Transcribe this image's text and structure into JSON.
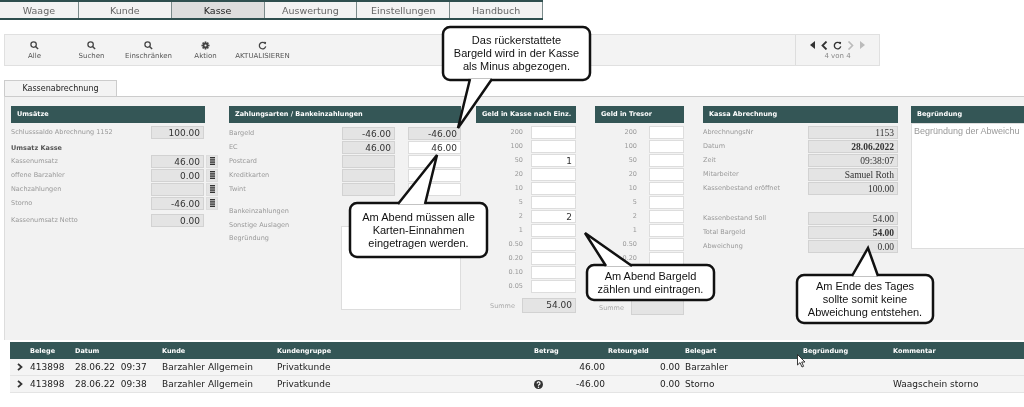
{
  "main_tabs": [
    {
      "label": "Waage",
      "selected": false
    },
    {
      "label": "Kunde",
      "selected": false
    },
    {
      "label": "Kasse",
      "selected": true
    },
    {
      "label": "Auswertung",
      "selected": false
    },
    {
      "label": "Einstellungen",
      "selected": false
    },
    {
      "label": "Handbuch",
      "selected": false
    }
  ],
  "toolbar": {
    "buttons": [
      {
        "label": "Alle",
        "kind": "search"
      },
      {
        "label": "Suchen",
        "kind": "search"
      },
      {
        "label": "Einschränken",
        "kind": "search"
      },
      {
        "label": "Aktion",
        "kind": "gear"
      },
      {
        "label": "AKTUALISIEREN",
        "kind": "refresh"
      }
    ],
    "pager": "4 von 4"
  },
  "sub_tabs": [
    {
      "label": "Kassenabrechnung",
      "selected": true
    }
  ],
  "umsaetze": {
    "title": "Umsätze",
    "rows": [
      {
        "kind": "field",
        "label": "Schlusssaldo Abrechnung 1152",
        "value": "100.00",
        "list_button": false
      },
      {
        "kind": "heading",
        "label": "Umsatz Kasse"
      },
      {
        "kind": "field",
        "label": "Kassenumsatz",
        "value": "46.00",
        "list_button": true
      },
      {
        "kind": "field",
        "label": "offene Barzahler",
        "value": "0.00",
        "list_button": true
      },
      {
        "kind": "field",
        "label": "Nachzahlungen",
        "list_button": true
      },
      {
        "kind": "field",
        "label": "Storno",
        "value": "-46.00",
        "list_button": true
      },
      {
        "kind": "field",
        "label": "Kassenumsatz Netto",
        "value": "0.00",
        "list_button": false
      }
    ]
  },
  "zahlungsarten": {
    "title": "Zahlungsarten / Bankeinzahlungen",
    "rows": [
      {
        "label": "Bargeld",
        "fields": [
          {
            "value": "-46.00",
            "editable": false
          },
          {
            "value": "-46.00",
            "editable": false
          }
        ]
      },
      {
        "label": "EC",
        "fields": [
          {
            "value": "46.00",
            "editable": false
          },
          {
            "value": "46.00",
            "editable": true
          }
        ]
      },
      {
        "label": "Postcard",
        "fields": [
          {
            "editable": false
          },
          {
            "editable": true
          }
        ]
      },
      {
        "label": "Kreditkarten",
        "fields": [
          {
            "editable": false
          },
          {
            "editable": true
          }
        ]
      },
      {
        "label": "Twint",
        "fields": [
          {
            "editable": false
          },
          {
            "editable": true
          }
        ]
      }
    ],
    "bank_label": "Bankeinzahlungen",
    "auslagen_label": "Sonstige Auslagen",
    "begruendung_label": "Begründung"
  },
  "geld_kasse": {
    "title": "Geld in Kasse nach Einz.",
    "denominations": [
      {
        "label": "200"
      },
      {
        "label": "100"
      },
      {
        "label": "50",
        "count": "1"
      },
      {
        "label": "20"
      },
      {
        "label": "10"
      },
      {
        "label": "5"
      },
      {
        "label": "2",
        "count": "2"
      },
      {
        "label": "1"
      },
      {
        "label": "0.50"
      },
      {
        "label": "0.20"
      },
      {
        "label": "0.10"
      },
      {
        "label": "0.05"
      }
    ],
    "summe_label": "Summe",
    "summe": "54.00"
  },
  "geld_tresor": {
    "title": "Geld in Tresor",
    "denominations": [
      {
        "label": "200"
      },
      {
        "label": "100"
      },
      {
        "label": "50"
      },
      {
        "label": "20"
      },
      {
        "label": "10"
      },
      {
        "label": "5"
      },
      {
        "label": "2"
      },
      {
        "label": "1"
      },
      {
        "label": "0.50"
      },
      {
        "label": "0.20"
      }
    ],
    "summe_label": "Summe"
  },
  "kassa_abrechnung": {
    "title": "Kassa Abrechnung",
    "groups": [
      [
        {
          "label": "AbrechnungsNr",
          "value": "1153",
          "bold": false
        },
        {
          "label": "Datum",
          "value": "28.06.2022",
          "bold": true
        },
        {
          "label": "Zeit",
          "value": "09:38:07",
          "bold": false
        },
        {
          "label": "Mitarbeiter",
          "value": "Samuel Roth",
          "bold": false
        },
        {
          "label": "Kassenbestand eröffnet",
          "value": "100.00",
          "bold": false
        }
      ],
      [
        {
          "label": "Kassenbestand Soll",
          "value": "54.00",
          "bold": false
        },
        {
          "label": "Total Bargeld",
          "value": "54.00",
          "bold": true
        },
        {
          "label": "Abweichung",
          "value": "0.00",
          "bold": false
        }
      ]
    ]
  },
  "begruendung": {
    "title": "Begründung",
    "placeholder": "Begründung der Abweichu"
  },
  "table": {
    "columns": [
      "Belege",
      "Datum",
      "Kunde",
      "Kundengruppe",
      "Betrag",
      "Retourgeld",
      "Belegart",
      "Begründung",
      "Kommentar"
    ],
    "rows": [
      {
        "expanded": false,
        "belege": "413898",
        "datum": "28.06.22  09:37",
        "kunde": "Barzahler Allgemein",
        "kundengruppe": "Privatkunde",
        "info_icon": false,
        "betrag": "46.00",
        "retourgeld": "0.00",
        "belegart": "Barzahler"
      },
      {
        "expanded": false,
        "belege": "413898",
        "datum": "28.06.22  09:38",
        "kunde": "Barzahler Allgemein",
        "kundengruppe": "Privatkunde",
        "info_icon": true,
        "betrag": "-46.00",
        "retourgeld": "0.00",
        "belegart": "Storno",
        "kommentar": "Waagschein storno"
      }
    ]
  },
  "callouts": [
    {
      "lines": [
        "Das rückerstattete",
        "Bargeld wird in der Kasse",
        "als Minus abgezogen."
      ]
    },
    {
      "lines": [
        "Am Abend müssen alle",
        "Karten-Einnahmen",
        "eingetragen werden."
      ]
    },
    {
      "lines": [
        "Am Abend Bargeld",
        "zählen und eintragen."
      ]
    },
    {
      "lines": [
        "Am Ende des Tages",
        "sollte somit keine",
        "Abweichung entstehen."
      ]
    }
  ]
}
